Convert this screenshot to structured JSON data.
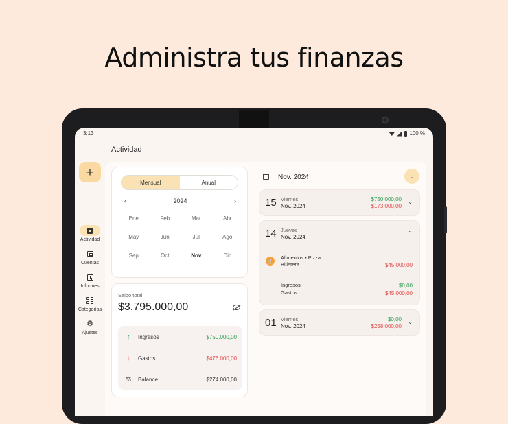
{
  "headline": "Administra tus finanzas",
  "status": {
    "time": "3:13",
    "battery": "100 %"
  },
  "page_title": "Actividad",
  "fab_label": "+",
  "nav": [
    {
      "label": "Actividad",
      "icon": "document-icon",
      "active": true
    },
    {
      "label": "Cuentas",
      "icon": "wallet-icon",
      "active": false
    },
    {
      "label": "Informes",
      "icon": "report-icon",
      "active": false
    },
    {
      "label": "Categorías",
      "icon": "grid-icon",
      "active": false
    },
    {
      "label": "Ajustes",
      "icon": "gear-icon",
      "active": false
    }
  ],
  "calendar": {
    "segments": [
      "Mensual",
      "Anual"
    ],
    "selected_segment": "Mensual",
    "year": "2024",
    "months": [
      "Ene",
      "Feb",
      "Mar",
      "Abr",
      "May",
      "Jun",
      "Jul",
      "Ago",
      "Sep",
      "Oct",
      "Nov",
      "Dic"
    ],
    "selected_month": "Nov"
  },
  "balance": {
    "label": "Saldo total",
    "value": "$3.795.000,00",
    "rows": [
      {
        "label": "Ingresos",
        "amount": "$750.000,00"
      },
      {
        "label": "Gastos",
        "amount": "$476.000,00"
      },
      {
        "label": "Balance",
        "amount": "$274.000,00"
      }
    ]
  },
  "period": {
    "title": "Nov. 2024"
  },
  "days": [
    {
      "num": "15",
      "weekday": "Viernes",
      "date": "Nov. 2024",
      "income": "$750.000,00",
      "expense": "$173.000,00"
    },
    {
      "num": "14",
      "weekday": "Jueves",
      "date": "Nov. 2024",
      "transaction": {
        "title": "Alimentos • Pizza",
        "account": "Billetera",
        "amount": "$45.000,00"
      },
      "summary": {
        "income_label": "Ingresos",
        "expense_label": "Gastos",
        "income": "$0,00",
        "expense": "$45.000,00"
      }
    },
    {
      "num": "01",
      "weekday": "Viernes",
      "date": "Nov. 2024",
      "income": "$0,00",
      "expense": "$258.000,00"
    }
  ],
  "colors": {
    "accent": "#fbe2b4",
    "fab": "#fbd9a3",
    "income": "#2e9e54",
    "expense": "#e04848",
    "background": "#fdeadc"
  }
}
